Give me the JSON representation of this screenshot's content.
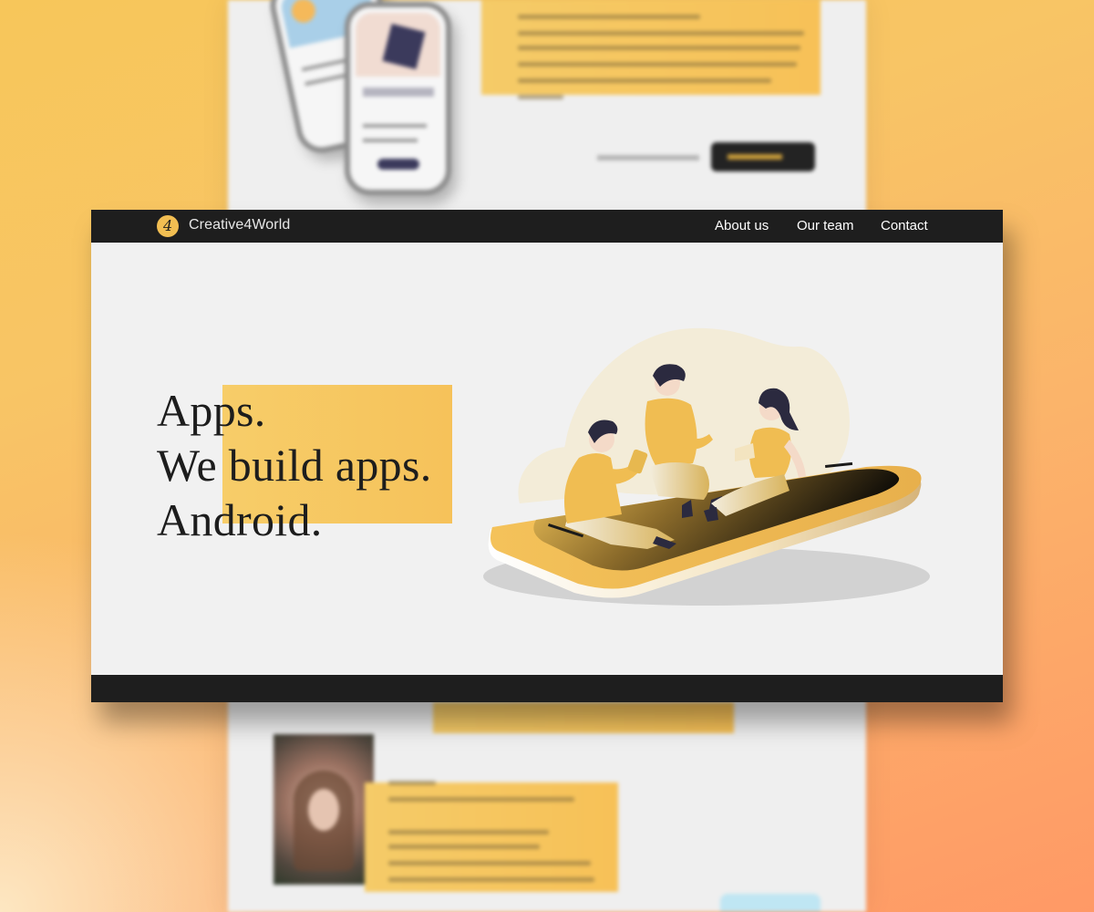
{
  "header": {
    "logo_glyph": "4",
    "brand": "Creative4World",
    "nav": [
      "About us",
      "Our team",
      "Contact"
    ]
  },
  "hero": {
    "lines": [
      "Apps.",
      "We build apps.",
      "Android."
    ]
  },
  "colors": {
    "accent": "#f6c25a",
    "nav_bg": "#1e1e1e",
    "page_bg": "#f1f1f1",
    "text": "#1d1d1d"
  }
}
